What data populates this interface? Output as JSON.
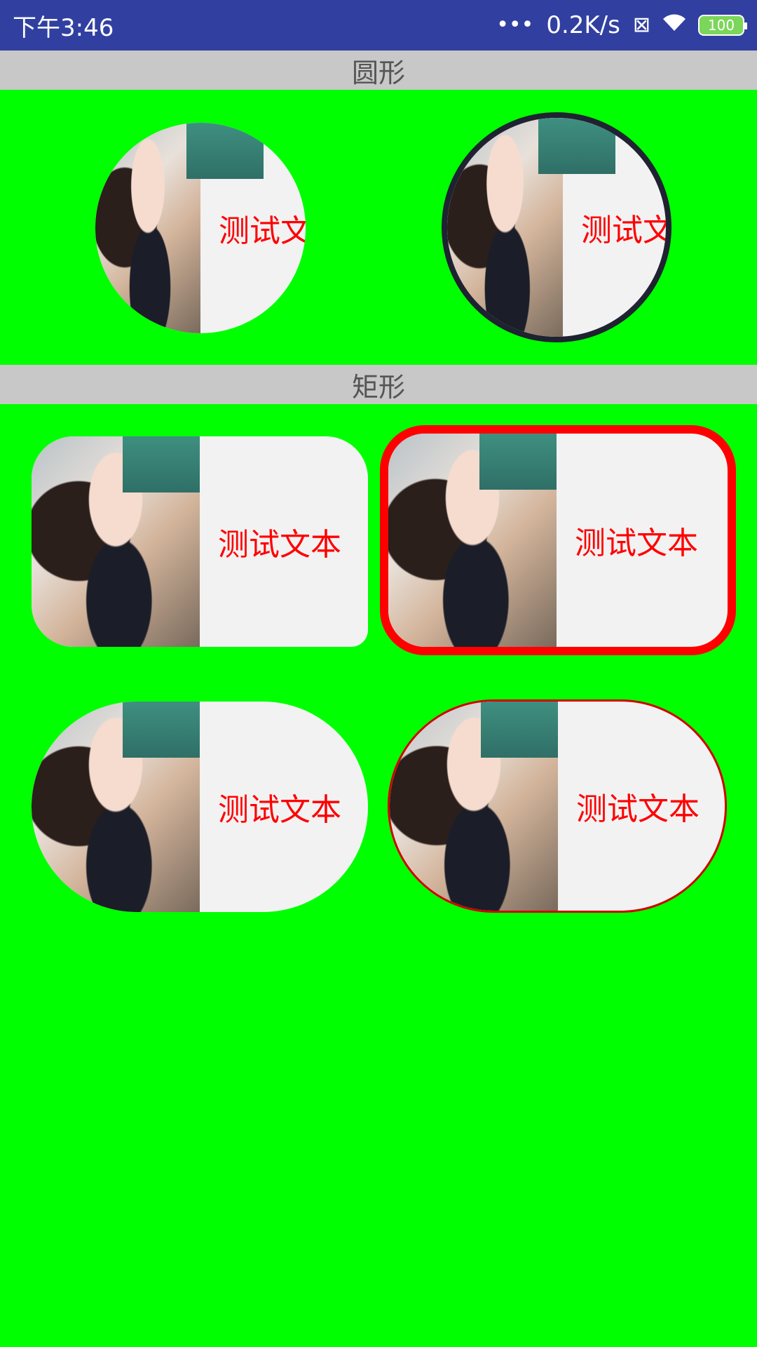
{
  "status_bar": {
    "time": "下午3:46",
    "dots": "•••",
    "speed": "0.2K/s",
    "sim_icon": "⊠",
    "wifi_icon": "wifi-icon",
    "battery": "100"
  },
  "sections": {
    "circle_title": "圆形",
    "rect_title": "矩形"
  },
  "tiles": {
    "circle1_text": "测试文本",
    "circle2_text": "测试文本",
    "rect1_text": "测试文本",
    "rect2_text": "测试文本",
    "rect3_text": "测试文本",
    "rect4_text": "测试文本"
  },
  "colors": {
    "background": "#00ff00",
    "status_bar": "#3140a0",
    "caption": "#ff0000",
    "border": "#ff0000"
  }
}
